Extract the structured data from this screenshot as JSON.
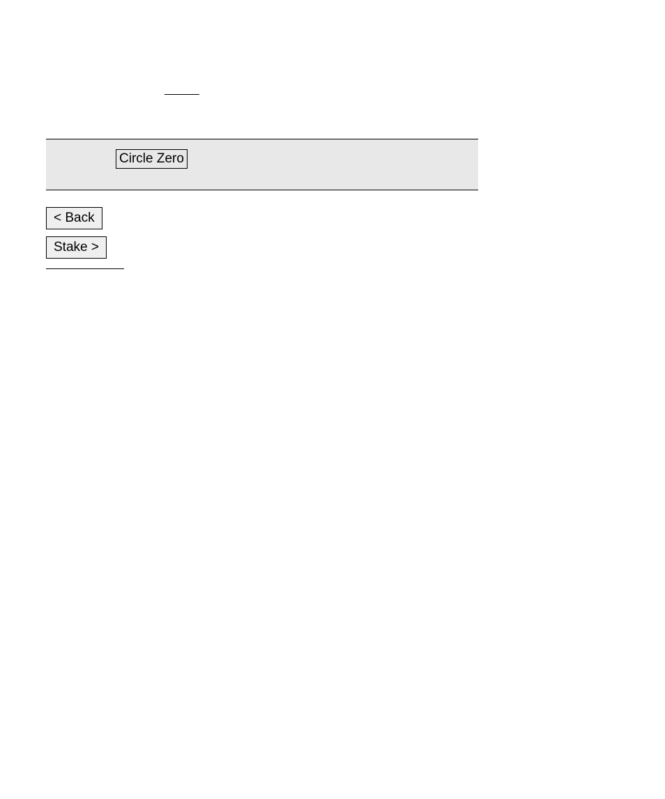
{
  "box": {
    "label": "Circle Zero"
  },
  "buttons": {
    "back": "< Back",
    "stake": "Stake >"
  }
}
